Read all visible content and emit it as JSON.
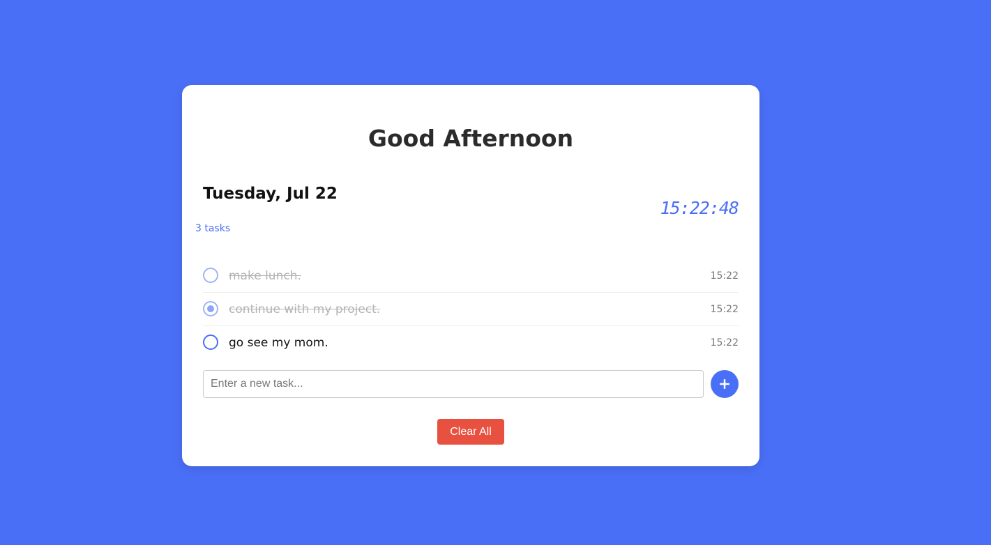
{
  "greeting": "Good Afternoon",
  "date": "Tuesday, Jul 22",
  "clock": "15:22:48",
  "task_count": "3 tasks",
  "tasks": [
    {
      "text": "make lunch.",
      "time": "15:22",
      "completed": true,
      "radio": "unchecked"
    },
    {
      "text": "continue with my project.",
      "time": "15:22",
      "completed": true,
      "radio": "checked"
    },
    {
      "text": "go see my mom.",
      "time": "15:22",
      "completed": false,
      "radio": "unchecked"
    }
  ],
  "new_task": {
    "placeholder": "Enter a new task...",
    "value": ""
  },
  "add_button": {
    "icon": "plus-icon"
  },
  "clear_button": {
    "label": "Clear All"
  },
  "colors": {
    "background": "#4a6ff7",
    "accent": "#4a6ff7",
    "danger": "#e8503f",
    "card": "#ffffff"
  }
}
